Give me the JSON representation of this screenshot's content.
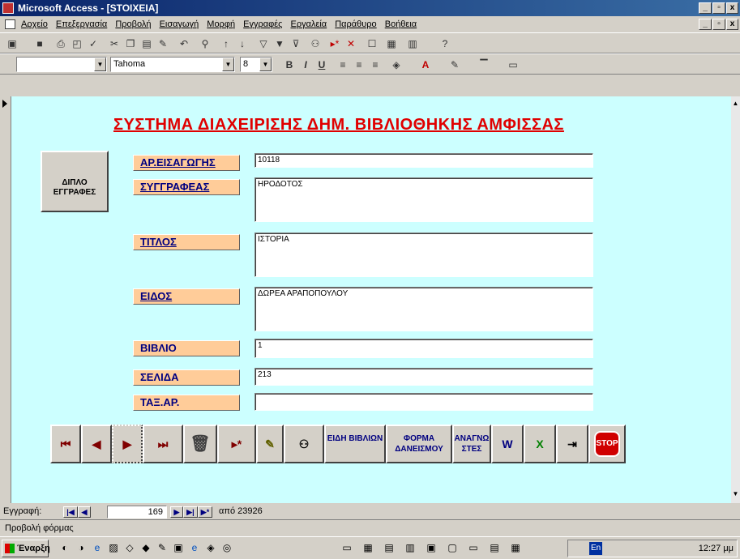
{
  "window": {
    "title": "Microsoft Access - [STOIXEIA]"
  },
  "menu": [
    "Αρχείο",
    "Επεξεργασία",
    "Προβολή",
    "Εισαγωγή",
    "Μορφή",
    "Εγγραφές",
    "Εργαλεία",
    "Παράθυρο",
    "Βοήθεια"
  ],
  "format_toolbar": {
    "font": "Tahoma",
    "size": "8"
  },
  "form": {
    "heading": "ΣΥΣΤΗΜΑ ΔΙΑΧΕΙΡΙΣΗΣ ΔΗΜ. ΒΙΒΛΙΟΘΗΚΗΣ ΑΜΦΙΣΣΑΣ",
    "duplicate_button": "ΔΙΠΛΟ ΕΓΓΡΑΦΕΣ",
    "fields": {
      "entry_no": {
        "label": "ΑΡ.ΕΙΣΑΓΩΓΗΣ",
        "value": "10118"
      },
      "author": {
        "label": "ΣΥΓΓΡΑΦΕΑΣ",
        "value": "ΗΡΟΔΟΤΟΣ"
      },
      "title": {
        "label": "ΤΙΤΛΟΣ",
        "value": "ΙΣΤΟΡΙΑ"
      },
      "kind": {
        "label": "ΕΙΔΟΣ",
        "value": "ΔΩΡΕΑ ΑΡΑΠΟΠΟΥΛΟΥ"
      },
      "book": {
        "label": "ΒΙΒΛΙΟ",
        "value": "1"
      },
      "page": {
        "label": "ΣΕΛΙΔΑ",
        "value": "213"
      },
      "shelf": {
        "label": "ΤΑΞ.ΑΡ.",
        "value": ""
      }
    },
    "nav_buttons": {
      "book_types": "ΕΙΔΗ ΒΙΒΛΙΩΝ",
      "loan_form": "ΦΟΡΜΑ ΔΑΝΕΙΣΜΟΥ",
      "readers": "ΑΝΑΓΝΩ ΣΤΕΣ",
      "stop": "STOP"
    }
  },
  "record_nav": {
    "label": "Εγγραφή:",
    "current": "169",
    "total_text": "από 23926"
  },
  "status": {
    "view": "Προβολή φόρμας"
  },
  "taskbar": {
    "start": "Έναρξη",
    "lang": "En",
    "clock": "12:27 μμ"
  }
}
